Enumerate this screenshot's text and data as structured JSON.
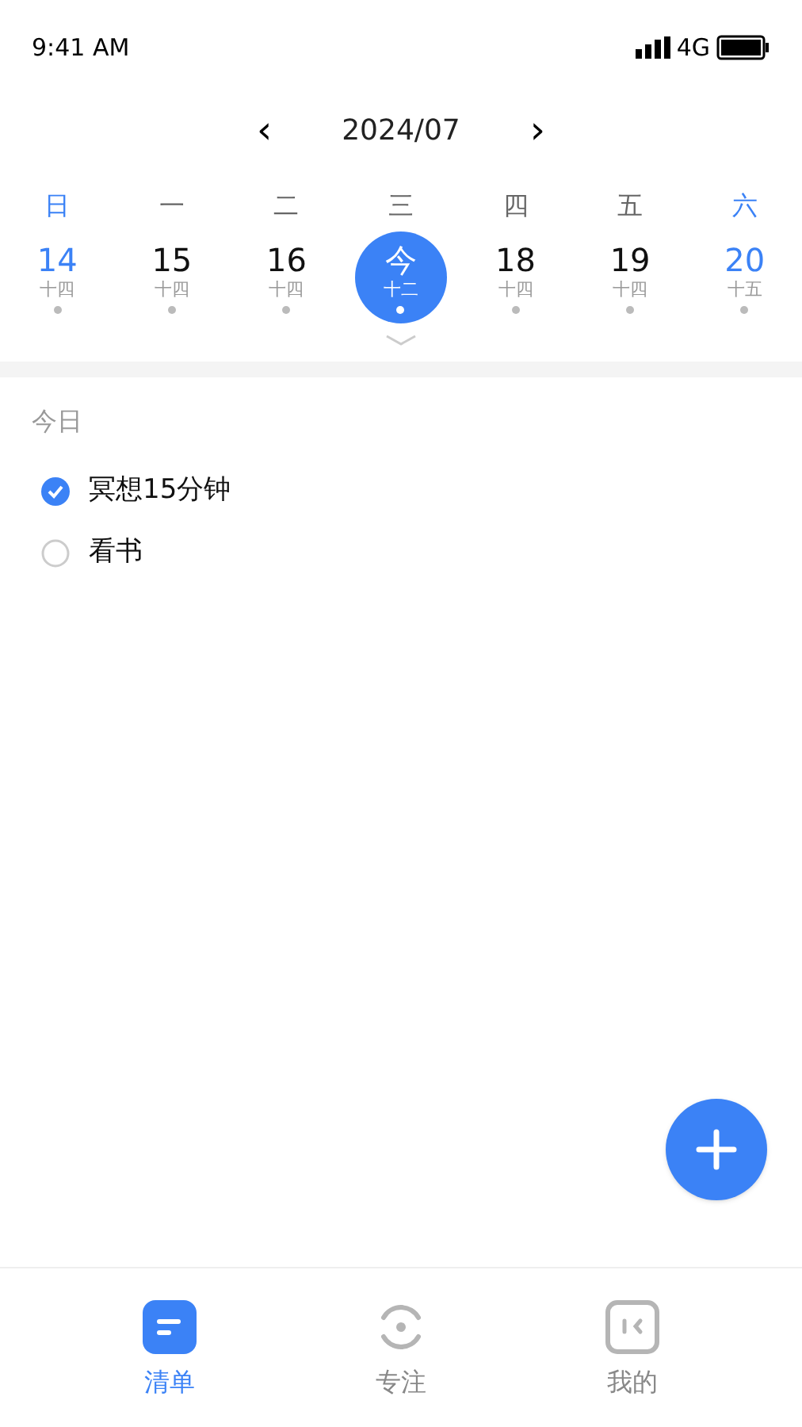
{
  "status_bar": {
    "time": "9:41 AM",
    "network": "4G"
  },
  "month_nav": {
    "prev": "‹",
    "title": "2024/07",
    "next": "›"
  },
  "week": [
    {
      "weekday": "日",
      "date": "14",
      "lunar": "十四",
      "weekend": true,
      "selected": false
    },
    {
      "weekday": "一",
      "date": "15",
      "lunar": "十四",
      "weekend": false,
      "selected": false
    },
    {
      "weekday": "二",
      "date": "16",
      "lunar": "十四",
      "weekend": false,
      "selected": false
    },
    {
      "weekday": "三",
      "date": "今",
      "lunar": "十二",
      "weekend": false,
      "selected": true
    },
    {
      "weekday": "四",
      "date": "18",
      "lunar": "十四",
      "weekend": false,
      "selected": false
    },
    {
      "weekday": "五",
      "date": "19",
      "lunar": "十四",
      "weekend": false,
      "selected": false
    },
    {
      "weekday": "六",
      "date": "20",
      "lunar": "十五",
      "weekend": true,
      "selected": false
    }
  ],
  "section_title": "今日",
  "tasks": [
    {
      "title": "冥想15分钟",
      "checked": true
    },
    {
      "title": "看书",
      "checked": false
    }
  ],
  "tab_bar": [
    {
      "label": "清单",
      "kind": "list",
      "selected": true
    },
    {
      "label": "专注",
      "kind": "focus",
      "selected": false
    },
    {
      "label": "我的",
      "kind": "profile",
      "selected": false
    }
  ]
}
